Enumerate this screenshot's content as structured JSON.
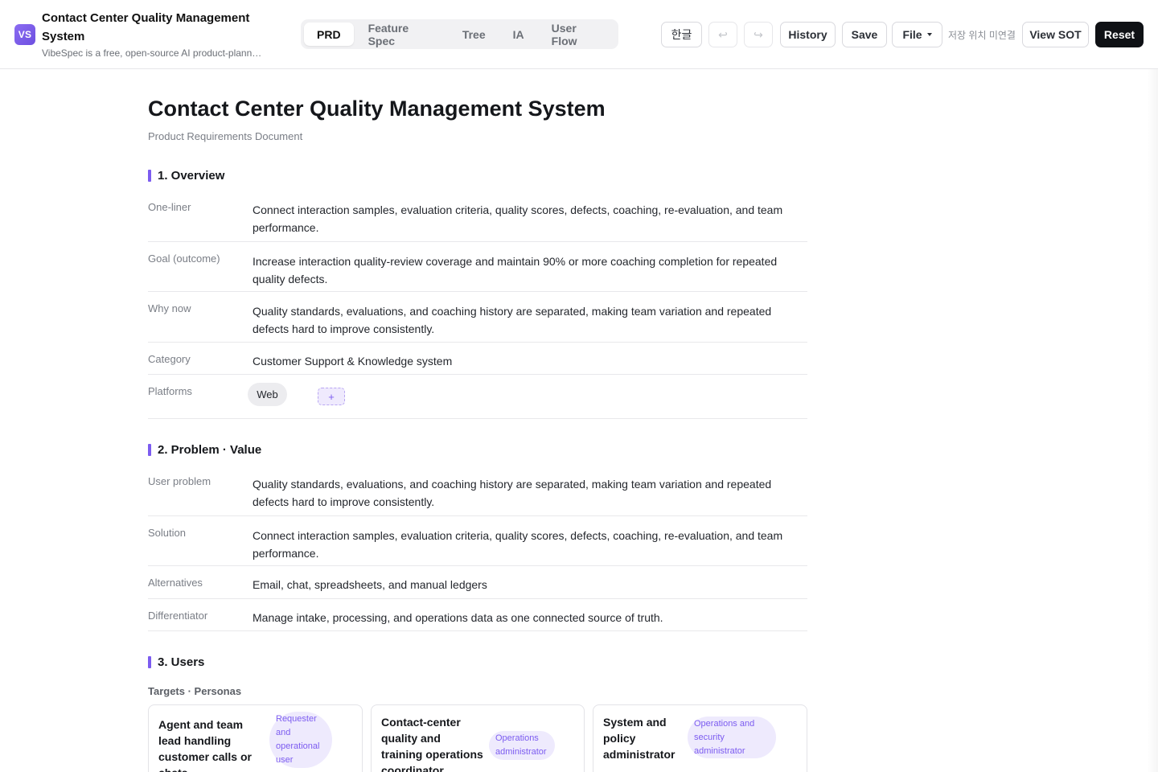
{
  "app": {
    "logo_text": "VS",
    "title": "Contact Center Quality Management System",
    "subtitle": "VibeSpec is a free, open-source AI product-planning tool"
  },
  "tabs": [
    {
      "label": "PRD",
      "active": true
    },
    {
      "label": "Feature Spec",
      "active": false
    },
    {
      "label": "Tree",
      "active": false
    },
    {
      "label": "IA",
      "active": false
    },
    {
      "label": "User Flow",
      "active": false
    }
  ],
  "toolbar": {
    "language": "한글",
    "undo_icon": "↩",
    "redo_icon": "↪",
    "history": "History",
    "save": "Save",
    "file": "File",
    "save_location": "저장 위치 미연결",
    "view_sot": "View SOT",
    "reset": "Reset"
  },
  "doc": {
    "title": "Contact Center Quality Management System",
    "subtitle": "Product Requirements Document",
    "overview": {
      "heading": "1. Overview",
      "one_liner_label": "One-liner",
      "one_liner": "Connect interaction samples, evaluation criteria, quality scores, defects, coaching, re-evaluation, and team performance.",
      "goal_label": "Goal (outcome)",
      "goal": "Increase interaction quality-review coverage and maintain 90% or more coaching completion for repeated quality defects.",
      "why_now_label": "Why now",
      "why_now": "Quality standards, evaluations, and coaching history are separated, making team variation and repeated defects hard to improve consistently.",
      "category_label": "Category",
      "category": "Customer Support & Knowledge system",
      "platforms_label": "Platforms",
      "platform_web": "Web",
      "platform_add": "+"
    },
    "problem": {
      "heading": "2. Problem · Value",
      "user_problem_label": "User problem",
      "user_problem": "Quality standards, evaluations, and coaching history are separated, making team variation and repeated defects hard to improve consistently.",
      "solution_label": "Solution",
      "solution": "Connect interaction samples, evaluation criteria, quality scores, defects, coaching, re-evaluation, and team performance.",
      "alternatives_label": "Alternatives",
      "alternatives": "Email, chat, spreadsheets, and manual ledgers",
      "differentiator_label": "Differentiator",
      "differentiator": "Manage intake, processing, and operations data as one connected source of truth."
    },
    "users": {
      "heading": "3. Users",
      "subheading": "Targets · Personas",
      "personas": [
        {
          "name": "Agent and team lead handling customer calls or chats",
          "role": "Requester and operational user"
        },
        {
          "name": "Contact-center quality and training operations coordinator",
          "role": "Operations administrator"
        },
        {
          "name": "System and policy administrator",
          "role": "Operations and security administrator"
        }
      ]
    }
  },
  "colors": {
    "accent": "#7c5cf0",
    "accent_soft": "#eeeafd",
    "dark_button": "#0f1115"
  }
}
